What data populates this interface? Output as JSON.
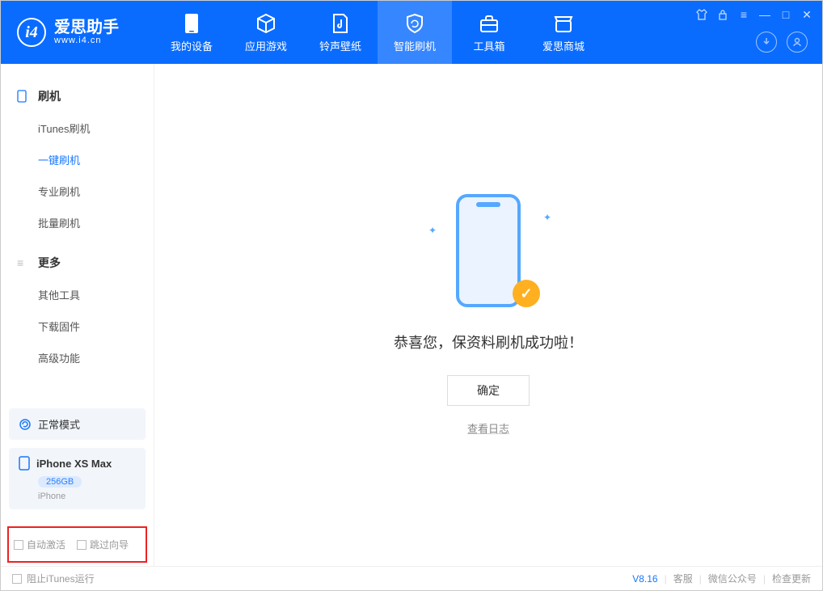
{
  "app": {
    "title": "爱思助手",
    "subtitle": "www.i4.cn",
    "logo_letter": "i4"
  },
  "nav": [
    {
      "label": "我的设备"
    },
    {
      "label": "应用游戏"
    },
    {
      "label": "铃声壁纸"
    },
    {
      "label": "智能刷机"
    },
    {
      "label": "工具箱"
    },
    {
      "label": "爱思商城"
    }
  ],
  "sidebar": {
    "section1": {
      "title": "刷机",
      "items": [
        "iTunes刷机",
        "一键刷机",
        "专业刷机",
        "批量刷机"
      ]
    },
    "section2": {
      "title": "更多",
      "items": [
        "其他工具",
        "下载固件",
        "高级功能"
      ]
    },
    "mode_label": "正常模式",
    "device": {
      "name": "iPhone XS Max",
      "capacity": "256GB",
      "type": "iPhone"
    },
    "checkboxes": {
      "auto_activate": "自动激活",
      "skip_guide": "跳过向导"
    }
  },
  "main": {
    "success_text": "恭喜您，保资料刷机成功啦！",
    "ok_button": "确定",
    "log_link": "查看日志"
  },
  "footer": {
    "block_itunes": "阻止iTunes运行",
    "version": "V8.16",
    "links": [
      "客服",
      "微信公众号",
      "检查更新"
    ]
  }
}
